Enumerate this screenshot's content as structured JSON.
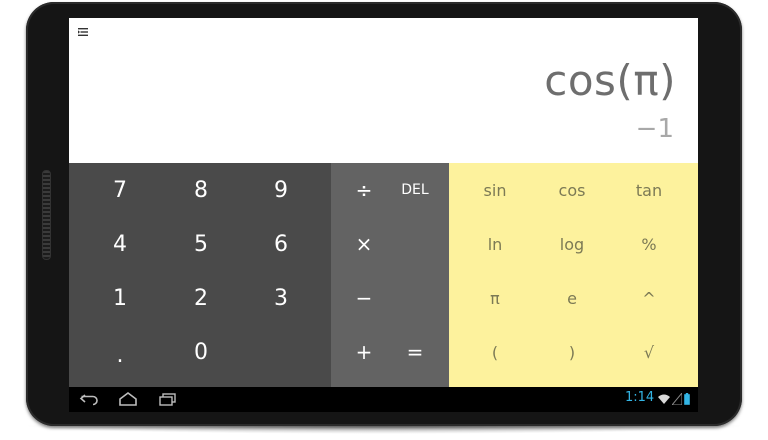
{
  "display": {
    "formula": "cos(π)",
    "result": "−1"
  },
  "keypad": {
    "numbers": [
      {
        "id": "key-7",
        "label": "7"
      },
      {
        "id": "key-8",
        "label": "8"
      },
      {
        "id": "key-9",
        "label": "9"
      },
      {
        "id": "key-4",
        "label": "4"
      },
      {
        "id": "key-5",
        "label": "5"
      },
      {
        "id": "key-6",
        "label": "6"
      },
      {
        "id": "key-1",
        "label": "1"
      },
      {
        "id": "key-2",
        "label": "2"
      },
      {
        "id": "key-3",
        "label": "3"
      },
      {
        "id": "key-decimal",
        "label": "."
      },
      {
        "id": "key-0",
        "label": "0"
      }
    ],
    "operators": [
      {
        "id": "key-divide",
        "label": "÷"
      },
      {
        "id": "key-del",
        "label": "DEL"
      },
      {
        "id": "key-multiply",
        "label": "×"
      },
      {
        "id": "key-minus",
        "label": "−"
      },
      {
        "id": "key-plus",
        "label": "+"
      },
      {
        "id": "key-equals",
        "label": "="
      }
    ],
    "advanced": [
      {
        "id": "key-sin",
        "label": "sin"
      },
      {
        "id": "key-cos",
        "label": "cos"
      },
      {
        "id": "key-tan",
        "label": "tan"
      },
      {
        "id": "key-ln",
        "label": "ln"
      },
      {
        "id": "key-log",
        "label": "log"
      },
      {
        "id": "key-percent",
        "label": "%"
      },
      {
        "id": "key-pi",
        "label": "π"
      },
      {
        "id": "key-e",
        "label": "e"
      },
      {
        "id": "key-power",
        "label": "^"
      },
      {
        "id": "key-open-paren",
        "label": "("
      },
      {
        "id": "key-close-paren",
        "label": ")"
      },
      {
        "id": "key-sqrt",
        "label": "√"
      }
    ]
  },
  "status_bar": {
    "time": "1:14"
  },
  "icons": {
    "menu": "overflow-menu-icon",
    "back": "back-icon",
    "home": "home-icon",
    "recents": "recent-apps-icon",
    "wifi": "wifi-icon",
    "signal": "signal-icon",
    "battery": "battery-icon"
  },
  "colors": {
    "numpad": "#4a4a4a",
    "operator_pad": "#636363",
    "advanced_pad": "#fdf29d",
    "time_accent": "#33b5e5"
  }
}
